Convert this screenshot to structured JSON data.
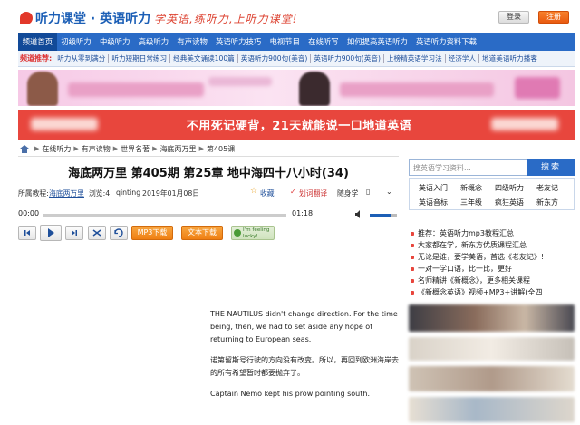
{
  "header": {
    "logo_text": "听力课堂 · 英语听力",
    "slogan": "学英语,练听力,上听力课堂!",
    "login_label": "登录",
    "register_label": "注册"
  },
  "nav": {
    "items": [
      "频道首页",
      "初级听力",
      "中级听力",
      "高级听力",
      "有声读物",
      "英语听力技巧",
      "电视节目",
      "在线听写",
      "如何提高英语听力",
      "英语听力资料下载"
    ],
    "active_index": 0
  },
  "subnav": {
    "lead": "频道推荐:",
    "items": [
      "听力从零到满分",
      "听力短期日常练习",
      "经典美文诵读100篇",
      "英语听力900句(美音)",
      "英语听力900句(英音)",
      "上榜精英语学习法",
      "经济学人",
      "地道美语听力播客"
    ]
  },
  "banner2": {
    "slogan": "不用死记硬背，21天就能说一口地道英语"
  },
  "breadcrumb": {
    "items": [
      "在线听力",
      "有声读物",
      "世界名著",
      "海底两万里",
      "第405课"
    ]
  },
  "article": {
    "title": "海底两万里 第405期 第25章 地中海四十八小时(34)",
    "meta": {
      "program_label": "所属教程:",
      "program_name": "海底两万里",
      "views": "浏览:4",
      "author": "qinting",
      "date": "2019年01月08日",
      "favorite": "收藏",
      "translate": "划词翻译",
      "random_study": "随身学"
    },
    "player": {
      "time_current": "00:00",
      "time_total": "01:18",
      "volume_level": 0.75
    },
    "buttons": {
      "mp3": "MP3下载",
      "text": "文本下载",
      "lucky": "I'm feeling lucky!"
    },
    "paragraphs": [
      "THE NAUTILUS didn't change direction. For the time being, then, we had to set aside any hope of returning to European seas.",
      "诺第留斯号行驶的方向没有改变。所以，再回到欧洲海岸去的所有希望暂时都要抛弃了。",
      "Captain Nemo kept his prow pointing south."
    ]
  },
  "sidebar": {
    "search_placeholder": "搜英语学习资料...",
    "search_button": "搜索",
    "quick_links": [
      "英语入门",
      "新概念",
      "四级听力",
      "老友记",
      "英语音标",
      "三年级",
      "疯狂英语",
      "新东方"
    ],
    "recommend": [
      "推荐：英语听力mp3教程汇总",
      "大家都在学，新东方优质课程汇总",
      "无论是谁，要学美语，首选《老友记》!",
      "一对一学口语，比一比，更好",
      "名师精讲《新概念》，更多相关课程",
      "《新概念英语》视频+MP3+讲解(全四"
    ]
  },
  "colors": {
    "brand_blue": "#2a6bc6",
    "accent_red": "#e8463d",
    "download_orange": "#ef7f12"
  }
}
